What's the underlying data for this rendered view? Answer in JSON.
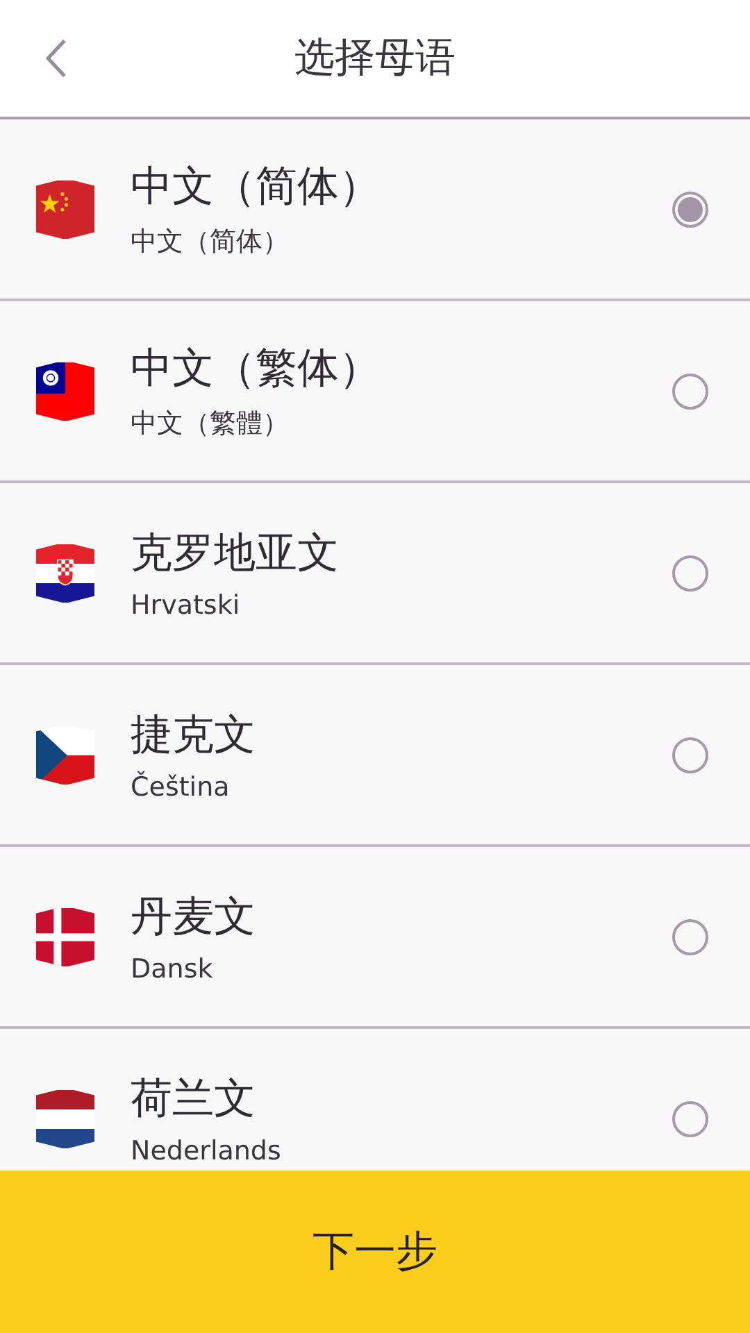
{
  "header": {
    "title": "选择母语"
  },
  "languages": [
    {
      "kind": "cn",
      "name": "中文（简体）",
      "native": "中文（简体）",
      "selected": true
    },
    {
      "kind": "tw",
      "name": "中文（繁体）",
      "native": "中文（繁體）",
      "selected": false
    },
    {
      "kind": "hr",
      "name": "克罗地亚文",
      "native": "Hrvatski",
      "selected": false
    },
    {
      "kind": "cz",
      "name": "捷克文",
      "native": "Čeština",
      "selected": false
    },
    {
      "kind": "dk",
      "name": "丹麦文",
      "native": "Dansk",
      "selected": false
    },
    {
      "kind": "nl",
      "name": "荷兰文",
      "native": "Nederlands",
      "selected": false
    }
  ],
  "next_button": "下一步"
}
